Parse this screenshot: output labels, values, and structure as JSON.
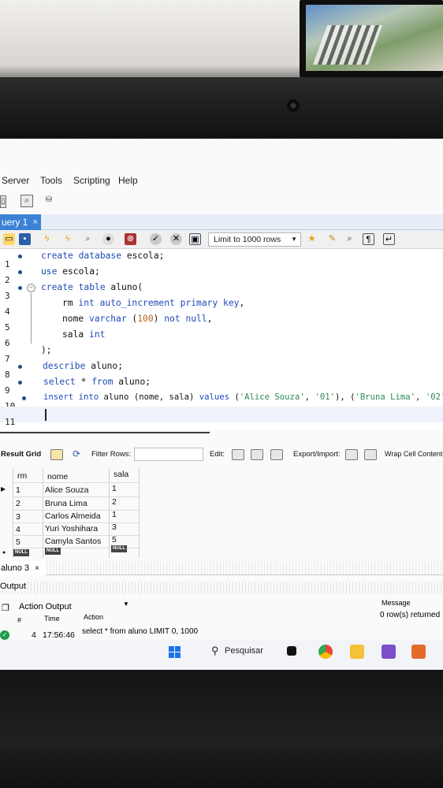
{
  "menu": {
    "items": [
      "Server",
      "Tools",
      "Scripting",
      "Help"
    ]
  },
  "tabs": {
    "query_tab": "uery 1",
    "close": "×"
  },
  "toolbar": {
    "limit_select": "Limit to 1000 rows"
  },
  "editor": {
    "line_numbers": [
      "1",
      "2",
      "3",
      "4",
      "5",
      "6",
      "7",
      "8",
      "9",
      "10",
      "11"
    ]
  },
  "result": {
    "title": "Result Grid",
    "filter_label": "Filter Rows:",
    "edit_label": "Edit:",
    "export_label": "Export/Import:",
    "wrap_label": "Wrap Cell Content",
    "columns": [
      "rm",
      "nome",
      "sala"
    ],
    "rows": [
      [
        "1",
        "Alice Souza",
        "1"
      ],
      [
        "2",
        "Bruna Lima",
        "2"
      ],
      [
        "3",
        "Carlos Almeida",
        "1"
      ],
      [
        "4",
        "Yuri Yoshihara",
        "3"
      ],
      [
        "5",
        "Camyla Santos",
        "5"
      ]
    ],
    "null_label": "NULL",
    "bottom_tab": "aluno 3",
    "bottom_tab_close": "×"
  },
  "output": {
    "label": "Output",
    "selector": "Action Output",
    "headers": {
      "num": "#",
      "time": "Time",
      "action": "Action",
      "message": "Message"
    },
    "row": {
      "num": "4",
      "time": "17:56:46",
      "action": "select * from aluno LIMIT 0, 1000",
      "message": "0 row(s) returned"
    }
  },
  "taskbar": {
    "search_label": "Pesquisar"
  },
  "colors": {
    "accent": "#3b82d6",
    "keyword": "#1f4ab8",
    "string": "#2e8b57",
    "ok": "#1e9c4a"
  }
}
